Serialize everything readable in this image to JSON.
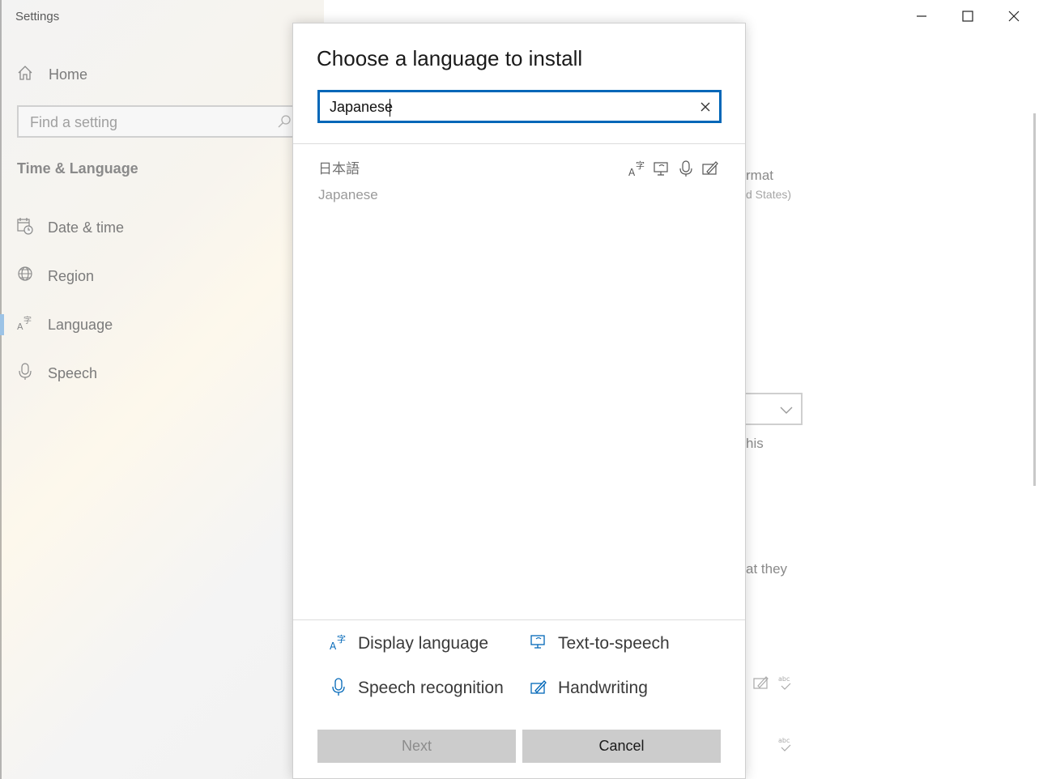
{
  "window": {
    "app_title": "Settings"
  },
  "sidebar": {
    "home_label": "Home",
    "search_placeholder": "Find a setting",
    "section_title": "Time & Language",
    "items": [
      {
        "label": "Date & time",
        "icon": "calendar-clock-icon"
      },
      {
        "label": "Region",
        "icon": "globe-icon"
      },
      {
        "label": "Language",
        "icon": "language-icon",
        "active": true
      },
      {
        "label": "Speech",
        "icon": "microphone-icon"
      }
    ]
  },
  "background": {
    "fragments": [
      "rmat",
      "d States)",
      "his",
      "at they"
    ]
  },
  "dialog": {
    "title": "Choose a language to install",
    "search_value": "Japanese",
    "results": [
      {
        "native_name": "日本語",
        "english_name": "Japanese",
        "features": [
          "display-language-icon",
          "text-to-speech-icon",
          "speech-recognition-icon",
          "handwriting-icon"
        ]
      }
    ],
    "legend": {
      "display_language": "Display language",
      "text_to_speech": "Text-to-speech",
      "speech_recognition": "Speech recognition",
      "handwriting": "Handwriting"
    },
    "buttons": {
      "next": "Next",
      "cancel": "Cancel"
    }
  },
  "colors": {
    "accent": "#0067b8",
    "button_bg": "#cccccc",
    "active_nav_bar": "#9cc3e6"
  }
}
